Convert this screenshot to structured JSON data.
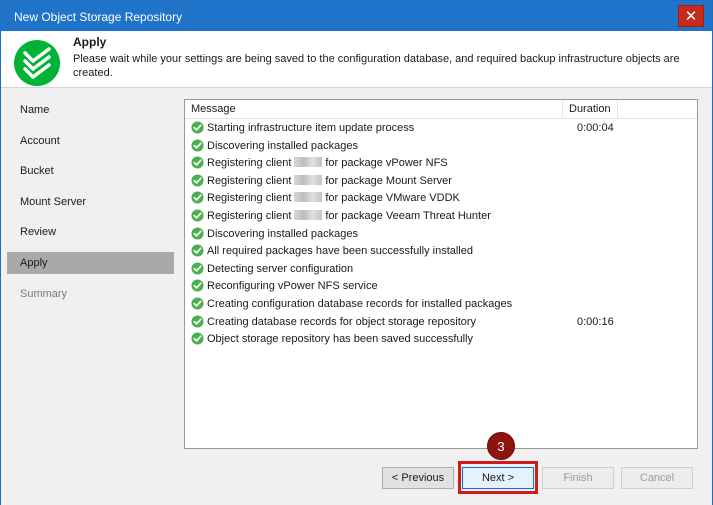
{
  "window": {
    "title": "New Object Storage Repository",
    "close_glyph": "✕"
  },
  "header": {
    "title": "Apply",
    "description": "Please wait while your settings are being saved to the configuration database, and required backup infrastructure objects are created."
  },
  "nav": {
    "items": [
      {
        "label": "Name"
      },
      {
        "label": "Account"
      },
      {
        "label": "Bucket"
      },
      {
        "label": "Mount Server"
      },
      {
        "label": "Review"
      },
      {
        "label": "Apply"
      },
      {
        "label": "Summary"
      }
    ]
  },
  "log": {
    "columns": {
      "message": "Message",
      "duration": "Duration"
    },
    "rows": [
      {
        "pre": "Starting infrastructure item update process",
        "post": "",
        "duration": "0:00:04"
      },
      {
        "pre": "Discovering installed packages",
        "post": "",
        "duration": ""
      },
      {
        "pre": "Registering client",
        "post": "for package vPower NFS",
        "duration": ""
      },
      {
        "pre": "Registering client",
        "post": "for package Mount Server",
        "duration": ""
      },
      {
        "pre": "Registering client",
        "post": "for package VMware VDDK",
        "duration": ""
      },
      {
        "pre": "Registering client",
        "post": "for package Veeam Threat Hunter",
        "duration": ""
      },
      {
        "pre": "Discovering installed packages",
        "post": "",
        "duration": ""
      },
      {
        "pre": "All required packages have been successfully installed",
        "post": "",
        "duration": ""
      },
      {
        "pre": "Detecting server configuration",
        "post": "",
        "duration": ""
      },
      {
        "pre": "Reconfiguring vPower NFS service",
        "post": "",
        "duration": ""
      },
      {
        "pre": "Creating configuration database records for installed packages",
        "post": "",
        "duration": ""
      },
      {
        "pre": "Creating database records for object storage repository",
        "post": "",
        "duration": "0:00:16"
      },
      {
        "pre": "Object storage repository has been saved successfully",
        "post": "",
        "duration": ""
      }
    ]
  },
  "buttons": {
    "previous": "< Previous",
    "next": "Next >",
    "finish": "Finish",
    "cancel": "Cancel"
  },
  "annotation": {
    "step": "3"
  },
  "colors": {
    "accent": "#1f73c9",
    "success": "#4caf50",
    "highlight": "#d11a1a",
    "badge": "#8e1410"
  }
}
